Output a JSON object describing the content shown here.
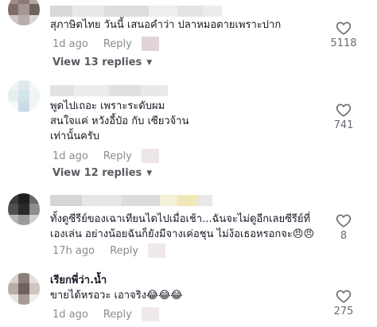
{
  "comments": [
    {
      "text": "สุภาษิตไทย วันนี้ เสนอคำว่า ปลาหมอตายเพราะปาก",
      "time": "1d ago",
      "reply_label": "Reply",
      "likes": "5118",
      "view_replies": "View 13 replies"
    },
    {
      "text": "พูดไปเถอะ เพราะระดับผม\nสนใจแค่ หวังอี้ป๋อ กับ เซียวจ้าน\nเท่านั้นครับ",
      "time": "1d ago",
      "reply_label": "Reply",
      "likes": "741",
      "view_replies": "View 12 replies"
    },
    {
      "text": "ทั้งดูซีรีย์ของเฉาเทียนไดไปเมื่อเช้า...ฉันจะไม่ดูอีกเลยซีรีย์ที่\nเองเล่น อย่างน้อยฉันก็ยังมีจางเค่อชุน ไม่ง้อเธอหรอกจะ😠😠",
      "time": "17h ago",
      "reply_label": "Reply",
      "likes": "8"
    },
    {
      "username": "เรียกพี่ว่า.น้ำ",
      "text": "ขายได้หรอวะ เอาจริง😂😂😂",
      "time": "1d ago",
      "reply_label": "Reply",
      "likes": "275"
    }
  ],
  "colors": {
    "text": "#161823",
    "meta": "#8a8b91",
    "count": "#6b6c72"
  },
  "icons": {
    "like": "heart-outline-icon",
    "expand": "chevron-down-icon"
  }
}
